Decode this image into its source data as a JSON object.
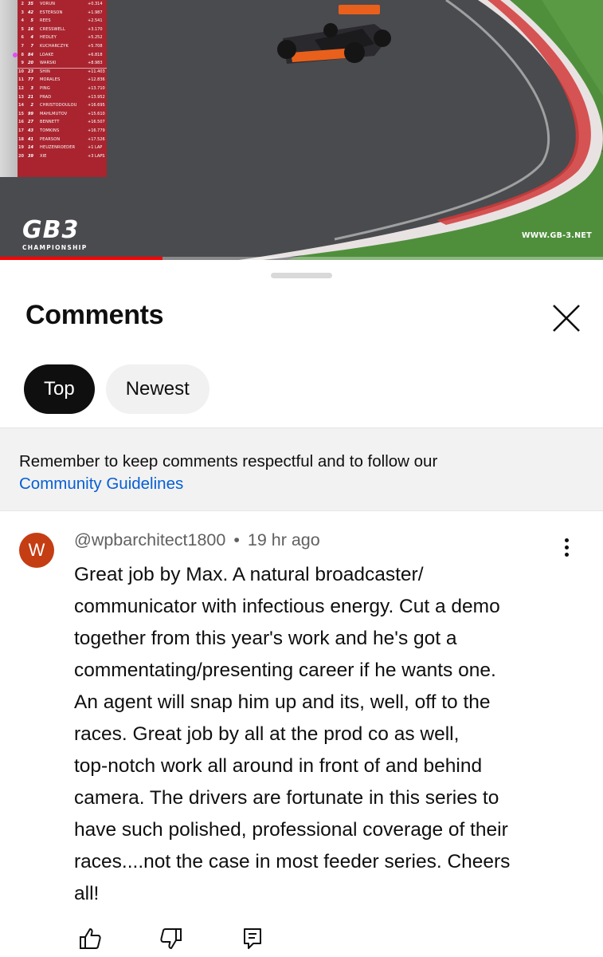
{
  "video": {
    "brand_logo": "GB3",
    "brand_sub": "CHAMPIONSHIP",
    "brand_url": "WWW.GB-3.NET",
    "progress_fraction": 0.27,
    "standings": [
      {
        "pos": "2",
        "num": "35",
        "name": "VORUN",
        "gap": "+0.314"
      },
      {
        "pos": "3",
        "num": "42",
        "name": "ESTERSON",
        "gap": "+1.987"
      },
      {
        "pos": "4",
        "num": "5",
        "name": "REES",
        "gap": "+2.541"
      },
      {
        "pos": "5",
        "num": "16",
        "name": "CRESSWELL",
        "gap": "+3.170"
      },
      {
        "pos": "6",
        "num": "4",
        "name": "HEDLEY",
        "gap": "+5.252"
      },
      {
        "pos": "7",
        "num": "7",
        "name": "KUCHARCZYK",
        "gap": "+5.708"
      },
      {
        "pos": "8",
        "num": "84",
        "name": "LOAKE",
        "gap": "+6.818"
      },
      {
        "pos": "9",
        "num": "20",
        "name": "WARSKI",
        "gap": "+8.983"
      },
      {
        "pos": "10",
        "num": "23",
        "name": "SHIN",
        "gap": "+11.403"
      },
      {
        "pos": "11",
        "num": "77",
        "name": "MORALES",
        "gap": "+12.836"
      },
      {
        "pos": "12",
        "num": "3",
        "name": "PING",
        "gap": "+13.710"
      },
      {
        "pos": "13",
        "num": "21",
        "name": "PRAD",
        "gap": "+13.952"
      },
      {
        "pos": "14",
        "num": "2",
        "name": "CHRISTODOULOU",
        "gap": "+16.695"
      },
      {
        "pos": "15",
        "num": "99",
        "name": "MAHLMUTOV",
        "gap": "+15.610"
      },
      {
        "pos": "16",
        "num": "27",
        "name": "BENNETT",
        "gap": "+16.507"
      },
      {
        "pos": "17",
        "num": "43",
        "name": "TOMKINS",
        "gap": "+16.779"
      },
      {
        "pos": "18",
        "num": "41",
        "name": "PEARSON",
        "gap": "+17.526"
      },
      {
        "pos": "19",
        "num": "14",
        "name": "HEUZENROEDER",
        "gap": "+1 LAP"
      },
      {
        "pos": "20",
        "num": "39",
        "name": "XIE",
        "gap": "+3 LAPS"
      }
    ]
  },
  "sheet": {
    "title": "Comments",
    "close_icon": "close-icon",
    "tabs": [
      {
        "label": "Top",
        "active": true
      },
      {
        "label": "Newest",
        "active": false
      }
    ],
    "notice_text": "Remember to keep comments respectful and to follow our",
    "notice_link": "Community Guidelines"
  },
  "comment": {
    "avatar_letter": "W",
    "avatar_color": "#c53d13",
    "author": "@wpbarchitect1800",
    "separator": "•",
    "time": "19 hr ago",
    "lines": [
      "Great job by Max. A natural broadcaster/",
      "communicator with infectious energy. Cut a demo",
      "together from this year's work and he's got a",
      "commentating/presenting career if he wants one.",
      "An agent will snap him up and its, well, off to the",
      "races. Great job by all at the prod co as well,",
      "top-notch work all around in front of and behind",
      "camera. The drivers are fortunate in this series to",
      "have such polished, professional coverage of their",
      "races....not the case in most feeder series. Cheers",
      "all!"
    ],
    "actions": [
      "thumb-up-icon",
      "thumb-down-icon",
      "reply-icon"
    ]
  },
  "colors": {
    "accent_link": "#065fd4",
    "progress": "#ff0000",
    "standings_bg": "#be1c28"
  }
}
